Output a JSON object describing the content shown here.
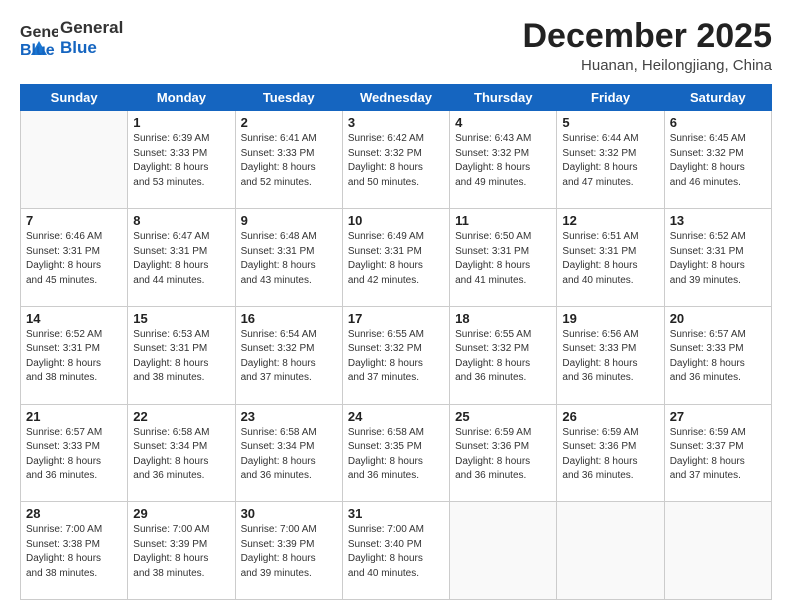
{
  "header": {
    "logo_line1": "General",
    "logo_line2": "Blue",
    "title": "December 2025",
    "subtitle": "Huanan, Heilongjiang, China"
  },
  "weekdays": [
    "Sunday",
    "Monday",
    "Tuesday",
    "Wednesday",
    "Thursday",
    "Friday",
    "Saturday"
  ],
  "weeks": [
    [
      {
        "day": "",
        "info": ""
      },
      {
        "day": "1",
        "info": "Sunrise: 6:39 AM\nSunset: 3:33 PM\nDaylight: 8 hours\nand 53 minutes."
      },
      {
        "day": "2",
        "info": "Sunrise: 6:41 AM\nSunset: 3:33 PM\nDaylight: 8 hours\nand 52 minutes."
      },
      {
        "day": "3",
        "info": "Sunrise: 6:42 AM\nSunset: 3:32 PM\nDaylight: 8 hours\nand 50 minutes."
      },
      {
        "day": "4",
        "info": "Sunrise: 6:43 AM\nSunset: 3:32 PM\nDaylight: 8 hours\nand 49 minutes."
      },
      {
        "day": "5",
        "info": "Sunrise: 6:44 AM\nSunset: 3:32 PM\nDaylight: 8 hours\nand 47 minutes."
      },
      {
        "day": "6",
        "info": "Sunrise: 6:45 AM\nSunset: 3:32 PM\nDaylight: 8 hours\nand 46 minutes."
      }
    ],
    [
      {
        "day": "7",
        "info": "Sunrise: 6:46 AM\nSunset: 3:31 PM\nDaylight: 8 hours\nand 45 minutes."
      },
      {
        "day": "8",
        "info": "Sunrise: 6:47 AM\nSunset: 3:31 PM\nDaylight: 8 hours\nand 44 minutes."
      },
      {
        "day": "9",
        "info": "Sunrise: 6:48 AM\nSunset: 3:31 PM\nDaylight: 8 hours\nand 43 minutes."
      },
      {
        "day": "10",
        "info": "Sunrise: 6:49 AM\nSunset: 3:31 PM\nDaylight: 8 hours\nand 42 minutes."
      },
      {
        "day": "11",
        "info": "Sunrise: 6:50 AM\nSunset: 3:31 PM\nDaylight: 8 hours\nand 41 minutes."
      },
      {
        "day": "12",
        "info": "Sunrise: 6:51 AM\nSunset: 3:31 PM\nDaylight: 8 hours\nand 40 minutes."
      },
      {
        "day": "13",
        "info": "Sunrise: 6:52 AM\nSunset: 3:31 PM\nDaylight: 8 hours\nand 39 minutes."
      }
    ],
    [
      {
        "day": "14",
        "info": "Sunrise: 6:52 AM\nSunset: 3:31 PM\nDaylight: 8 hours\nand 38 minutes."
      },
      {
        "day": "15",
        "info": "Sunrise: 6:53 AM\nSunset: 3:31 PM\nDaylight: 8 hours\nand 38 minutes."
      },
      {
        "day": "16",
        "info": "Sunrise: 6:54 AM\nSunset: 3:32 PM\nDaylight: 8 hours\nand 37 minutes."
      },
      {
        "day": "17",
        "info": "Sunrise: 6:55 AM\nSunset: 3:32 PM\nDaylight: 8 hours\nand 37 minutes."
      },
      {
        "day": "18",
        "info": "Sunrise: 6:55 AM\nSunset: 3:32 PM\nDaylight: 8 hours\nand 36 minutes."
      },
      {
        "day": "19",
        "info": "Sunrise: 6:56 AM\nSunset: 3:33 PM\nDaylight: 8 hours\nand 36 minutes."
      },
      {
        "day": "20",
        "info": "Sunrise: 6:57 AM\nSunset: 3:33 PM\nDaylight: 8 hours\nand 36 minutes."
      }
    ],
    [
      {
        "day": "21",
        "info": "Sunrise: 6:57 AM\nSunset: 3:33 PM\nDaylight: 8 hours\nand 36 minutes."
      },
      {
        "day": "22",
        "info": "Sunrise: 6:58 AM\nSunset: 3:34 PM\nDaylight: 8 hours\nand 36 minutes."
      },
      {
        "day": "23",
        "info": "Sunrise: 6:58 AM\nSunset: 3:34 PM\nDaylight: 8 hours\nand 36 minutes."
      },
      {
        "day": "24",
        "info": "Sunrise: 6:58 AM\nSunset: 3:35 PM\nDaylight: 8 hours\nand 36 minutes."
      },
      {
        "day": "25",
        "info": "Sunrise: 6:59 AM\nSunset: 3:36 PM\nDaylight: 8 hours\nand 36 minutes."
      },
      {
        "day": "26",
        "info": "Sunrise: 6:59 AM\nSunset: 3:36 PM\nDaylight: 8 hours\nand 36 minutes."
      },
      {
        "day": "27",
        "info": "Sunrise: 6:59 AM\nSunset: 3:37 PM\nDaylight: 8 hours\nand 37 minutes."
      }
    ],
    [
      {
        "day": "28",
        "info": "Sunrise: 7:00 AM\nSunset: 3:38 PM\nDaylight: 8 hours\nand 38 minutes."
      },
      {
        "day": "29",
        "info": "Sunrise: 7:00 AM\nSunset: 3:39 PM\nDaylight: 8 hours\nand 38 minutes."
      },
      {
        "day": "30",
        "info": "Sunrise: 7:00 AM\nSunset: 3:39 PM\nDaylight: 8 hours\nand 39 minutes."
      },
      {
        "day": "31",
        "info": "Sunrise: 7:00 AM\nSunset: 3:40 PM\nDaylight: 8 hours\nand 40 minutes."
      },
      {
        "day": "",
        "info": ""
      },
      {
        "day": "",
        "info": ""
      },
      {
        "day": "",
        "info": ""
      }
    ]
  ]
}
